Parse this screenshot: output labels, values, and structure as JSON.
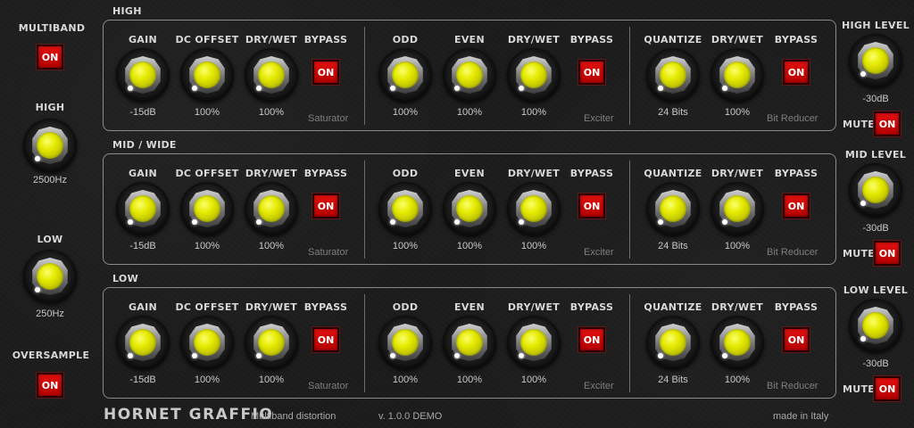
{
  "left": {
    "multiband_label": "MULTIBAND",
    "multiband_button": "ON",
    "high_label": "HIGH",
    "high_value": "2500Hz",
    "low_label": "LOW",
    "low_value": "250Hz",
    "oversample_label": "OVERSAMPLE",
    "oversample_button": "ON"
  },
  "bands": [
    {
      "title": "HIGH",
      "saturator": {
        "gain_label": "GAIN",
        "gain_value": "-15dB",
        "dc_label": "DC OFFSET",
        "dc_value": "100%",
        "drywet_label": "DRY/WET",
        "drywet_value": "100%",
        "bypass_label": "BYPASS",
        "bypass_button": "ON",
        "name": "Saturator"
      },
      "exciter": {
        "odd_label": "ODD",
        "odd_value": "100%",
        "even_label": "EVEN",
        "even_value": "100%",
        "drywet_label": "DRY/WET",
        "drywet_value": "100%",
        "bypass_label": "BYPASS",
        "bypass_button": "ON",
        "name": "Exciter"
      },
      "bitreducer": {
        "quantize_label": "QUANTIZE",
        "quantize_value": "24 Bits",
        "drywet_label": "DRY/WET",
        "drywet_value": "100%",
        "bypass_label": "BYPASS",
        "bypass_button": "ON",
        "name": "Bit Reducer"
      }
    },
    {
      "title": "MID / WIDE",
      "saturator": {
        "gain_label": "GAIN",
        "gain_value": "-15dB",
        "dc_label": "DC OFFSET",
        "dc_value": "100%",
        "drywet_label": "DRY/WET",
        "drywet_value": "100%",
        "bypass_label": "BYPASS",
        "bypass_button": "ON",
        "name": "Saturator"
      },
      "exciter": {
        "odd_label": "ODD",
        "odd_value": "100%",
        "even_label": "EVEN",
        "even_value": "100%",
        "drywet_label": "DRY/WET",
        "drywet_value": "100%",
        "bypass_label": "BYPASS",
        "bypass_button": "ON",
        "name": "Exciter"
      },
      "bitreducer": {
        "quantize_label": "QUANTIZE",
        "quantize_value": "24 Bits",
        "drywet_label": "DRY/WET",
        "drywet_value": "100%",
        "bypass_label": "BYPASS",
        "bypass_button": "ON",
        "name": "Bit Reducer"
      }
    },
    {
      "title": "LOW",
      "saturator": {
        "gain_label": "GAIN",
        "gain_value": "-15dB",
        "dc_label": "DC OFFSET",
        "dc_value": "100%",
        "drywet_label": "DRY/WET",
        "drywet_value": "100%",
        "bypass_label": "BYPASS",
        "bypass_button": "ON",
        "name": "Saturator"
      },
      "exciter": {
        "odd_label": "ODD",
        "odd_value": "100%",
        "even_label": "EVEN",
        "even_value": "100%",
        "drywet_label": "DRY/WET",
        "drywet_value": "100%",
        "bypass_label": "BYPASS",
        "bypass_button": "ON",
        "name": "Exciter"
      },
      "bitreducer": {
        "quantize_label": "QUANTIZE",
        "quantize_value": "24 Bits",
        "drywet_label": "DRY/WET",
        "drywet_value": "100%",
        "bypass_label": "BYPASS",
        "bypass_button": "ON",
        "name": "Bit Reducer"
      }
    }
  ],
  "right": [
    {
      "label": "HIGH LEVEL",
      "value": "-30dB",
      "mute_label": "MUTE",
      "mute_button": "ON"
    },
    {
      "label": "MID LEVEL",
      "value": "-30dB",
      "mute_label": "MUTE",
      "mute_button": "ON"
    },
    {
      "label": "LOW LEVEL",
      "value": "-30dB",
      "mute_label": "MUTE",
      "mute_button": "ON"
    }
  ],
  "footer": {
    "brand": "HORNET GRAFFIO",
    "subtitle": "Multiband distortion",
    "version": "v. 1.0.0 DEMO",
    "made_in": "made in Italy"
  },
  "colors": {
    "knob_face": "#e5ea00",
    "button_on": "#d00000",
    "background": "#1b1b1b",
    "frame": "#8a8a8a"
  }
}
